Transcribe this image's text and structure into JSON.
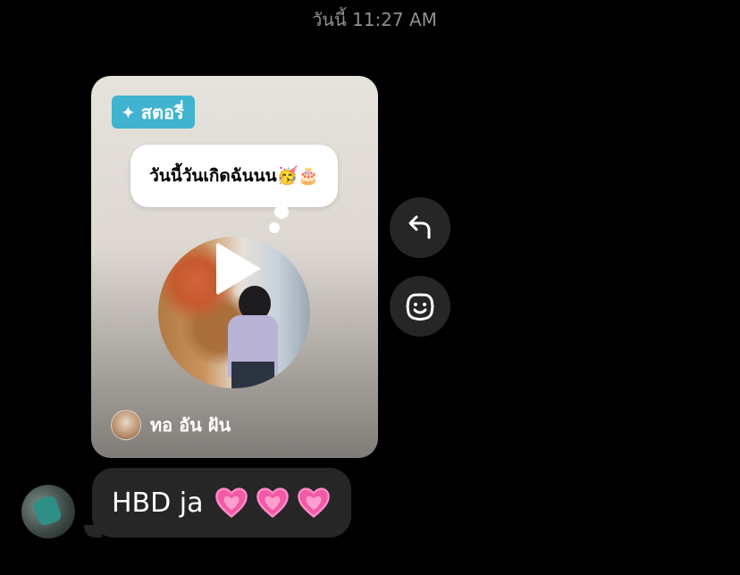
{
  "timestamp": "วันนี้ 11:27 AM",
  "story": {
    "badge_icon": "sparkle-icon",
    "badge_label": "สตอรี่",
    "caption": "วันนี้วันเกิดฉันนน🥳🎂",
    "author_name": "ทอ อัน ฝัน"
  },
  "message": {
    "text": "HBD ja",
    "hearts": [
      "heart-icon",
      "heart-icon",
      "heart-icon"
    ]
  },
  "colors": {
    "background": "#000000",
    "bubble": "#262626",
    "badge": "#3fb3cf",
    "heart": "#f25aa6"
  }
}
